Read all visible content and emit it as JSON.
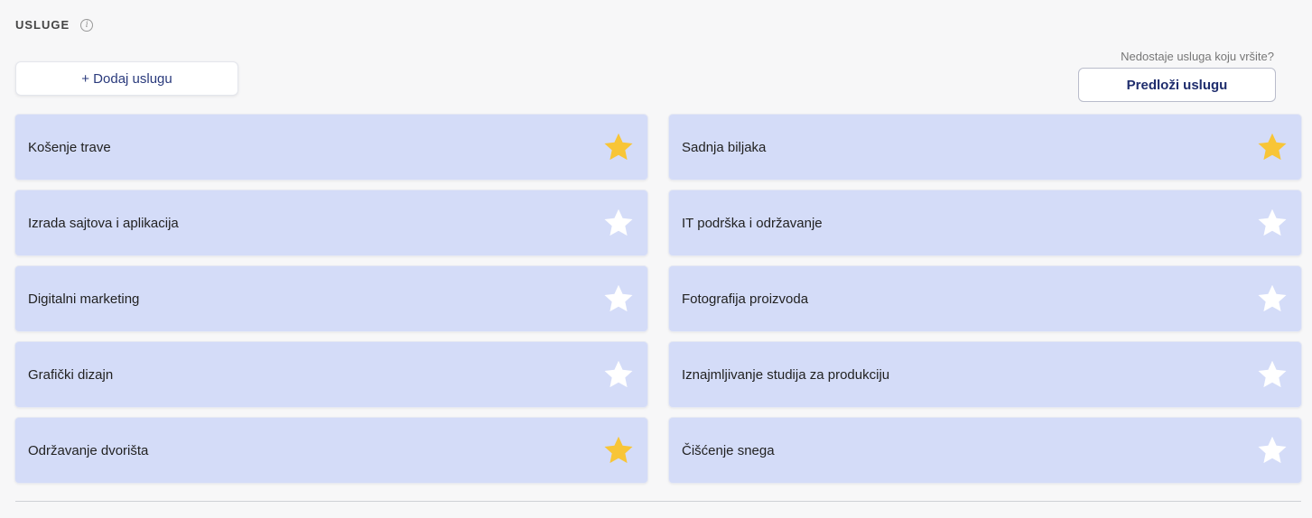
{
  "section": {
    "title": "USLUGE",
    "info_glyph": "i"
  },
  "actions": {
    "add_label": "+ Dodaj uslugu",
    "suggest_prompt": "Nedostaje usluga koju vršite?",
    "suggest_label": "Predloži uslugu"
  },
  "colors": {
    "star_on": "#f8c537",
    "star_off": "#ffffff",
    "card_bg": "#d4dcf8"
  },
  "services": [
    {
      "label": "Košenje trave",
      "favorite": true
    },
    {
      "label": "Sadnja biljaka",
      "favorite": true
    },
    {
      "label": "Izrada sajtova i aplikacija",
      "favorite": false
    },
    {
      "label": "IT podrška i održavanje",
      "favorite": false
    },
    {
      "label": "Digitalni marketing",
      "favorite": false
    },
    {
      "label": "Fotografija proizvoda",
      "favorite": false
    },
    {
      "label": "Grafički dizajn",
      "favorite": false
    },
    {
      "label": "Iznajmljivanje studija za produkciju",
      "favorite": false
    },
    {
      "label": "Održavanje dvorišta",
      "favorite": true
    },
    {
      "label": "Čišćenje snega",
      "favorite": false
    }
  ]
}
